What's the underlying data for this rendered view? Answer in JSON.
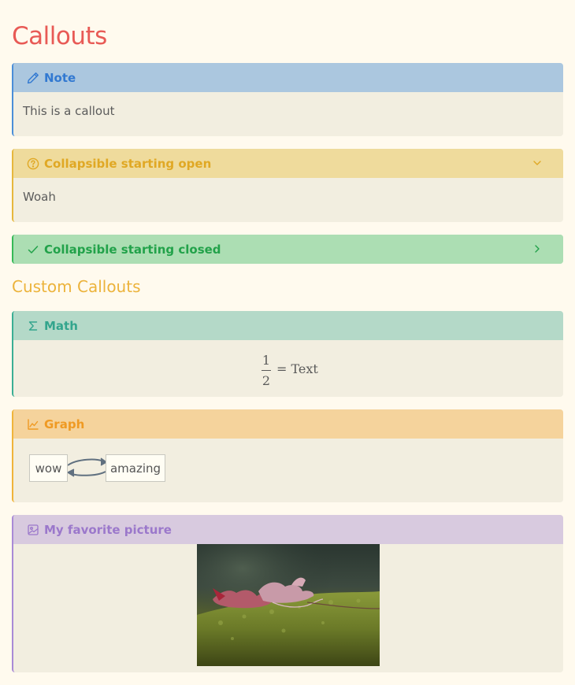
{
  "page": {
    "title": "Callouts"
  },
  "callouts": {
    "note": {
      "title": "Note",
      "icon": "pencil-icon",
      "content": "This is a callout"
    },
    "collapsible_open": {
      "title": "Collapsible starting open",
      "icon": "question-circle-icon",
      "content": "Woah",
      "collapsed": false
    },
    "collapsible_closed": {
      "title": "Collapsible starting closed",
      "icon": "check-icon",
      "collapsed": true
    }
  },
  "custom": {
    "heading": "Custom Callouts",
    "math": {
      "title": "Math",
      "icon": "sigma-icon",
      "fraction_numerator": "1",
      "fraction_denominator": "2",
      "equation_rhs": "= Text"
    },
    "graph": {
      "title": "Graph",
      "icon": "line-chart-icon",
      "nodes": [
        "wow",
        "amazing"
      ]
    },
    "picture": {
      "title": "My favorite picture",
      "icon": "image-icon"
    }
  },
  "colors": {
    "title": "#e85a55",
    "note": "#3279d1",
    "question": "#e0a824",
    "success": "#22a24a",
    "math": "#33a58d",
    "graph": "#ef9a23",
    "picture": "#9b78cb"
  }
}
